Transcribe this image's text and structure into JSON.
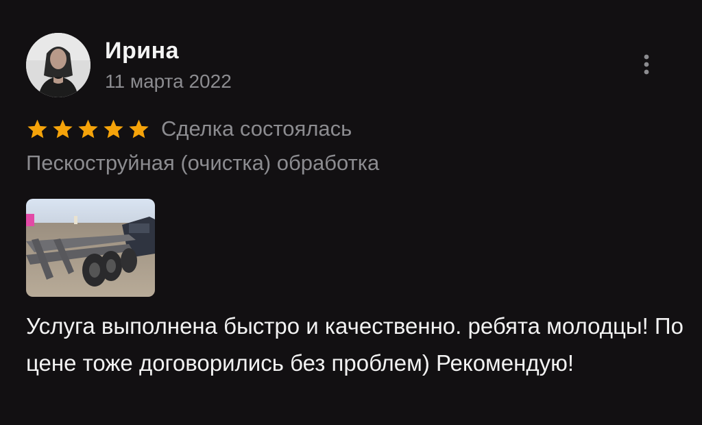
{
  "review": {
    "author_name": "Ирина",
    "date": "11 марта 2022",
    "rating": 5,
    "rating_max": 5,
    "deal_status": "Сделка состоялась",
    "service": "Пескоструйная (очистка) обработка",
    "text": "Услуга выполнена быстро и качественно. ребята молодцы! По цене тоже договорились без проблем) Рекомендую!"
  },
  "icons": {
    "more": "more-vertical-icon",
    "star": "star-icon"
  },
  "colors": {
    "background": "#121012",
    "star": "#F5A30A",
    "text_primary": "#F2F2F2",
    "text_secondary": "#8C8C90"
  }
}
